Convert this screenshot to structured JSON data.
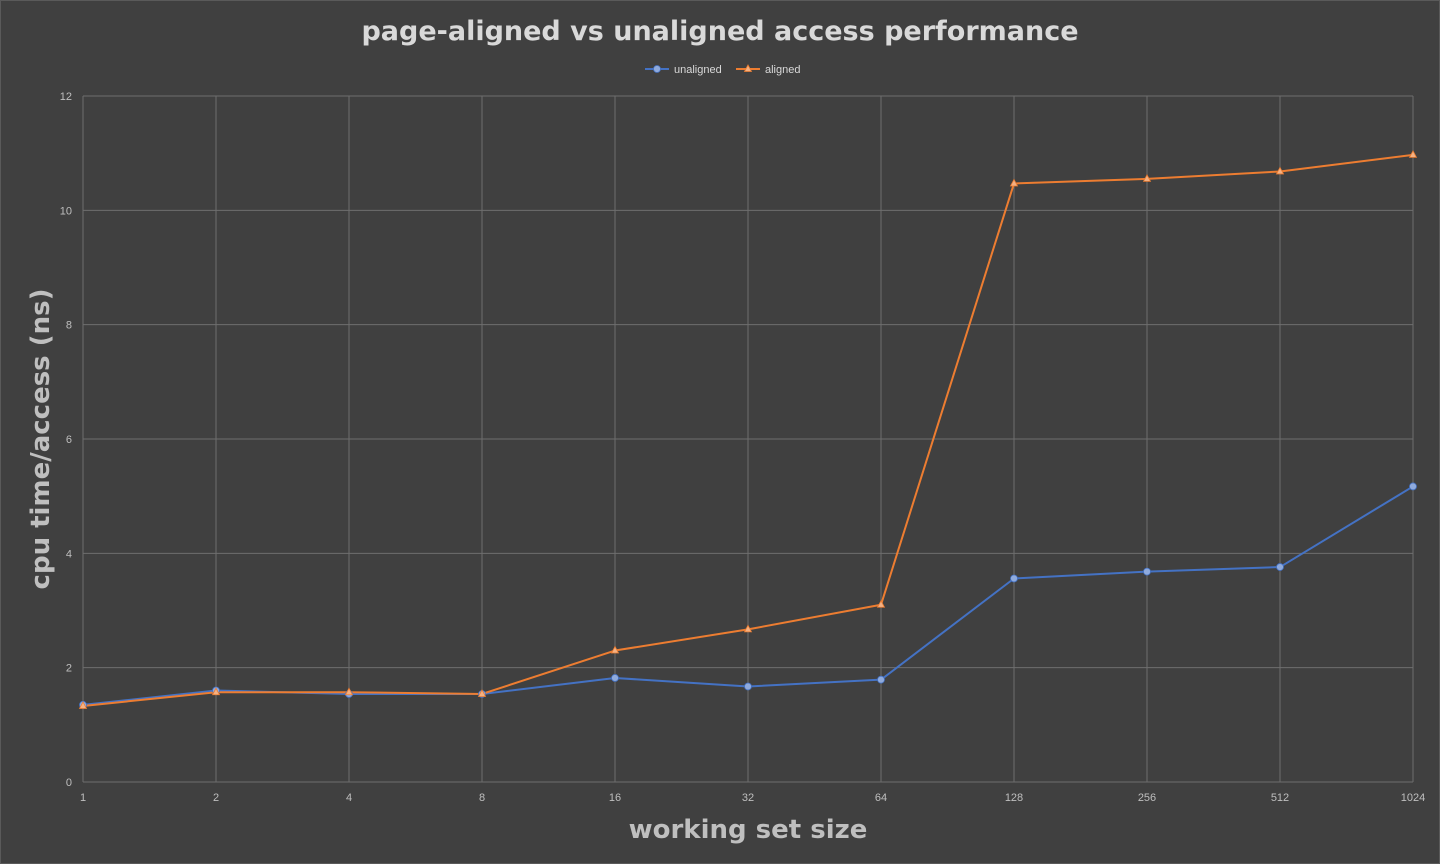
{
  "chart_data": {
    "type": "line",
    "title": "page-aligned vs unaligned access performance",
    "xlabel": "working set size",
    "ylabel": "cpu time/access (ns)",
    "categories": [
      "1",
      "2",
      "4",
      "8",
      "16",
      "32",
      "64",
      "128",
      "256",
      "512",
      "1024"
    ],
    "ylim": [
      0,
      12
    ],
    "yticks": [
      "0",
      "2",
      "4",
      "6",
      "8",
      "10",
      "12"
    ],
    "grid": true,
    "legend_position": "top-center",
    "series": [
      {
        "name": "unaligned",
        "color": "#4472c4",
        "marker": "circle",
        "values": [
          1.35,
          1.6,
          1.54,
          1.54,
          1.82,
          1.67,
          1.79,
          3.56,
          3.68,
          3.76,
          5.17
        ]
      },
      {
        "name": "aligned",
        "color": "#ed7d31",
        "marker": "triangle",
        "values": [
          1.33,
          1.57,
          1.57,
          1.54,
          2.3,
          2.67,
          3.1,
          10.47,
          10.55,
          10.68,
          10.97
        ]
      }
    ]
  }
}
